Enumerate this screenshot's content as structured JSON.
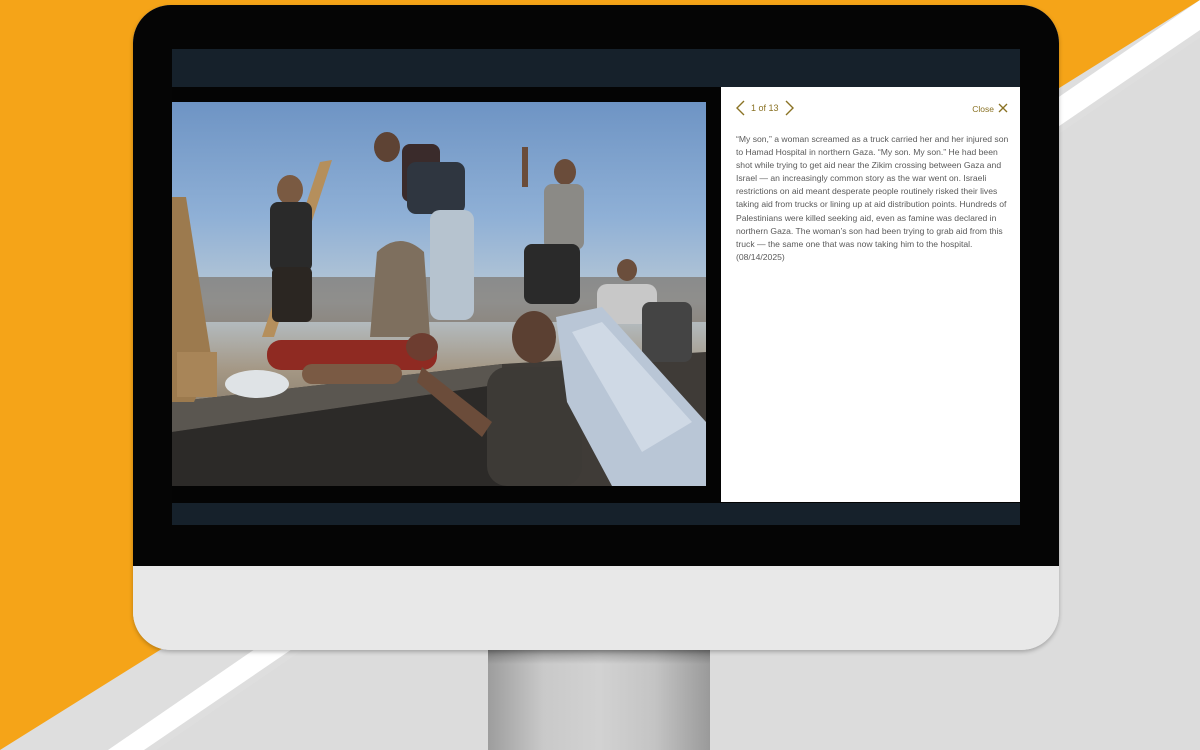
{
  "gallery": {
    "counter": "1 of 13",
    "close_label": "Close",
    "prev_icon": "chevron-left-icon",
    "next_icon": "chevron-right-icon",
    "close_icon": "close-x-icon",
    "caption": "“My son,” a woman screamed as a truck carried her and her injured son to Hamad Hospital in northern Gaza. “My son. My son.” He had been shot while trying to get aid near the Zikim crossing between Gaza and Israel — an increasingly common story as the war went on. Israeli restrictions on aid meant desperate people routinely risked their lives taking aid from trucks or lining up at aid distribution points. Hundreds of Palestinians were killed seeking aid, even as famine was declared in northern Gaza. The woman’s son had been trying to grab aid from this truck — the same one that was now taking him to the hospital. (08/14/2025)"
  },
  "colors": {
    "accent": "#8a7224",
    "background_orange": "#f5a418",
    "screen_bar": "#16212b",
    "caption_text": "#5a5a5a"
  }
}
